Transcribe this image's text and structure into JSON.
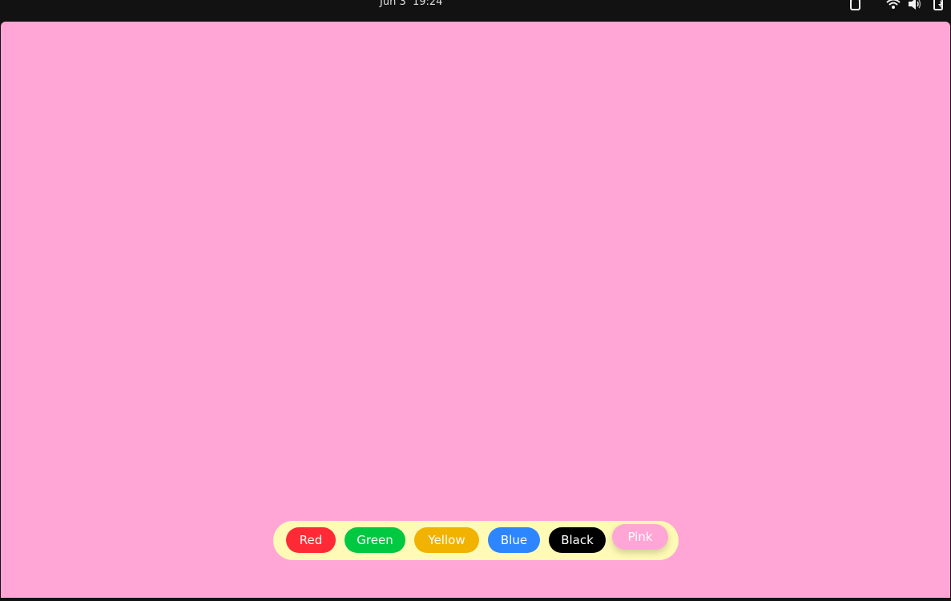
{
  "topbar": {
    "date": "Jun 3",
    "time": "19:24",
    "icons": [
      "clipboard-icon",
      "wifi-icon",
      "volume-icon",
      "battery-icon"
    ]
  },
  "canvas": {
    "background": "#ffa6d6"
  },
  "palette": {
    "background": "#fffbb6",
    "selected": "Pink",
    "colors": [
      {
        "label": "Red",
        "bg": "#ff2a35",
        "fg": "#ffffff"
      },
      {
        "label": "Green",
        "bg": "#00c840",
        "fg": "#ffffff"
      },
      {
        "label": "Yellow",
        "bg": "#f2b200",
        "fg": "#ffffff"
      },
      {
        "label": "Blue",
        "bg": "#2e86ff",
        "fg": "#ffffff"
      },
      {
        "label": "Black",
        "bg": "#000000",
        "fg": "#ffffff"
      },
      {
        "label": "Pink",
        "bg": "#ffa6d6",
        "fg": "#ffffff"
      }
    ]
  }
}
